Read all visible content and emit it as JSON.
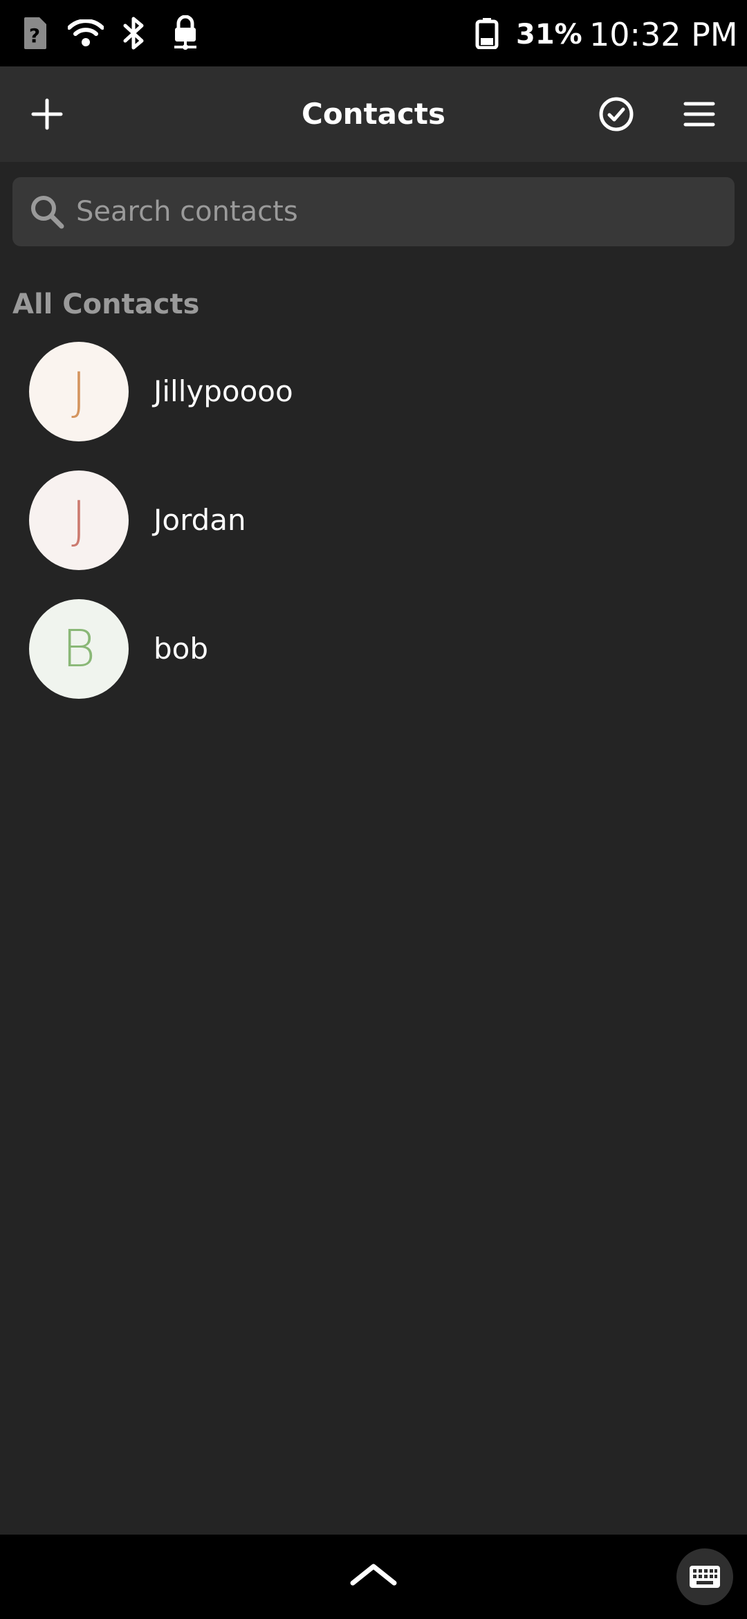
{
  "status_bar": {
    "battery_percent": "31%",
    "time": "10:32 PM",
    "icons": [
      "sim-unknown-icon",
      "wifi-icon",
      "bluetooth-icon",
      "vpn-lock-icon",
      "battery-icon"
    ]
  },
  "header": {
    "title": "Contacts",
    "add_icon": "plus-icon",
    "select_icon": "check-circle-icon",
    "menu_icon": "hamburger-menu-icon"
  },
  "search": {
    "placeholder": "Search contacts",
    "value": ""
  },
  "section": {
    "title": "All Contacts"
  },
  "contacts": [
    {
      "initial": "J",
      "name": "Jillypoooo",
      "avatar_bg": "#faf4ef",
      "initial_color": "#d4955f"
    },
    {
      "initial": "J",
      "name": "Jordan",
      "avatar_bg": "#f8f2f0",
      "initial_color": "#cc7b70"
    },
    {
      "initial": "B",
      "name": "bob",
      "avatar_bg": "#f0f4ee",
      "initial_color": "#8ab877"
    }
  ],
  "nav": {
    "up_icon": "chevron-up-icon",
    "keyboard_icon": "keyboard-icon"
  }
}
